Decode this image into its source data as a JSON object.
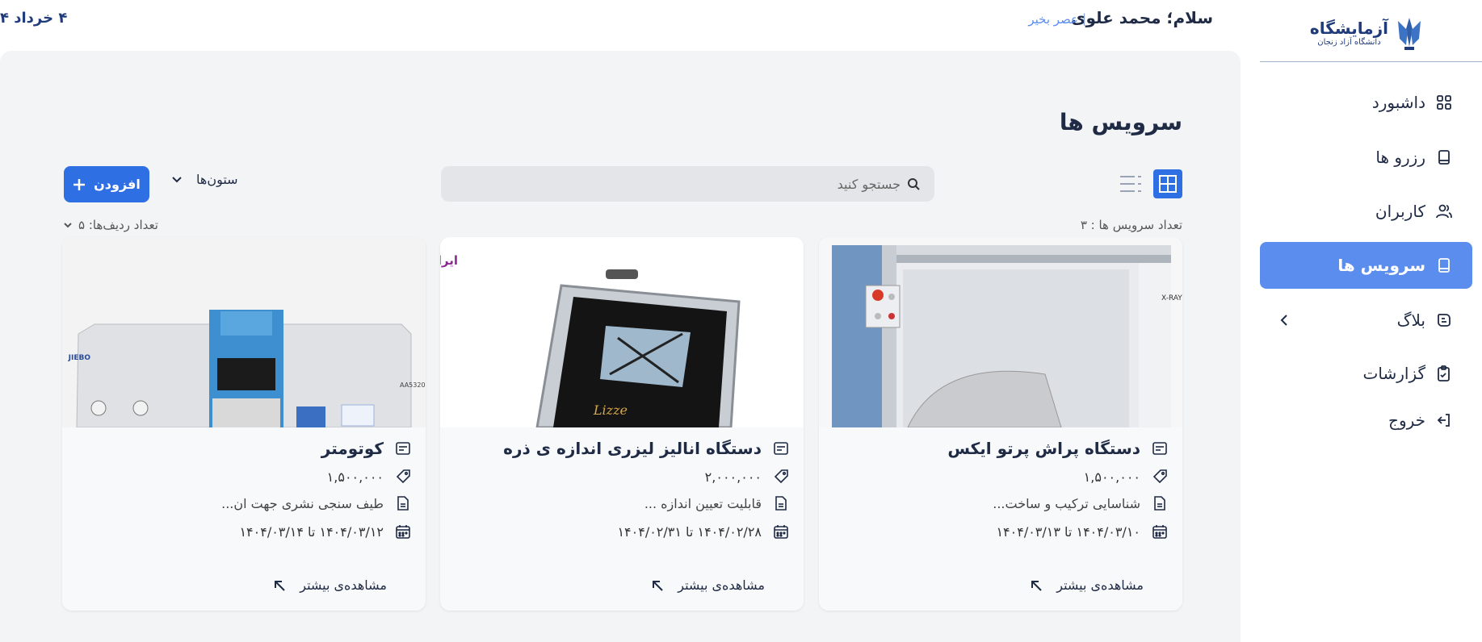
{
  "sidebar": {
    "logo": {
      "title": "آزمایشگاه",
      "subtitle": "دانشگاه آزاد زنجان"
    },
    "items": [
      {
        "label": "داشبورد",
        "icon": "dashboard-icon"
      },
      {
        "label": "رزرو ها",
        "icon": "book-icon"
      },
      {
        "label": "کاربران",
        "icon": "users-icon"
      },
      {
        "label": "سرویس ها",
        "icon": "service-icon",
        "active": true
      },
      {
        "label": "بلاگ",
        "icon": "blog-icon"
      },
      {
        "label": "گزارشات",
        "icon": "report-icon"
      },
      {
        "label": "خروج",
        "icon": "logout-icon"
      }
    ]
  },
  "header": {
    "greeting": "سلام؛ محمد علوی",
    "separator": "|",
    "sub_greeting": "عصر بخیر",
    "date": "۴ خرداد ۴"
  },
  "main": {
    "title": "سرویس ها",
    "search": {
      "placeholder": "جستجو کنید"
    },
    "columns_label": "ستون‌ها",
    "add_label": "افزودن",
    "count_label": "تعداد سرویس ها : ۳",
    "rows_label": "تعداد ردیف‌ها: ۵"
  },
  "cards": [
    {
      "title": "دستگاه پراش پرتو ایکس",
      "price": "۱,۵۰۰,۰۰۰",
      "description": "شناسایی ترکیب و ساخت...",
      "dates": "۱۴۰۴/۰۳/۱۰ تا ۱۴۰۴/۰۳/۱۳",
      "more": "مشاهده‌ی بیشتر",
      "image_text": "X-RAY"
    },
    {
      "title": "دستگاه انالیز لیزری اندازه ی ذره",
      "price": "۲,۰۰۰,۰۰۰",
      "description": "قابلیت تعیین اندازه ...",
      "dates": "۱۴۰۴/۰۲/۲۸ تا ۱۴۰۴/۰۲/۳۱",
      "more": "مشاهده‌ی بیشتر",
      "image_text": "Lizze",
      "brand_text": "ایرانکراتی"
    },
    {
      "title": "کوتومتر",
      "price": "۱,۵۰۰,۰۰۰",
      "description": "طیف سنجی نشری جهت ان...",
      "dates": "۱۴۰۴/۰۳/۱۲ تا ۱۴۰۴/۰۳/۱۴",
      "more": "مشاهده‌ی بیشتر",
      "image_text": "AA5320",
      "brand_text": "JIEBO"
    }
  ],
  "colors": {
    "accent": "#2f6fe4",
    "active_nav": "#5b8def",
    "panel": "#f3f4f6"
  }
}
